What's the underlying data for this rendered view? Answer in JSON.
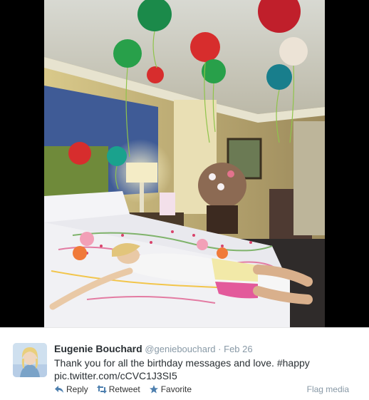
{
  "tweet": {
    "name": "Eugenie Bouchard",
    "handle": "@geniebouchard",
    "separator": "·",
    "time": "Feb 26",
    "text": "Thank you for all the birthday messages and love.",
    "hashtag": "#happy",
    "pic_link": "pic.twitter.com/cCVC1J3SI5"
  },
  "actions": {
    "reply": "Reply",
    "retweet": "Retweet",
    "favorite": "Favorite",
    "flag": "Flag media"
  },
  "icons": {
    "reply": "reply-arrow-icon",
    "retweet": "retweet-icon",
    "favorite": "star-icon"
  },
  "colors": {
    "action_icon": "#4d7fae",
    "meta_gray": "#8899a6",
    "text": "#292f33"
  }
}
